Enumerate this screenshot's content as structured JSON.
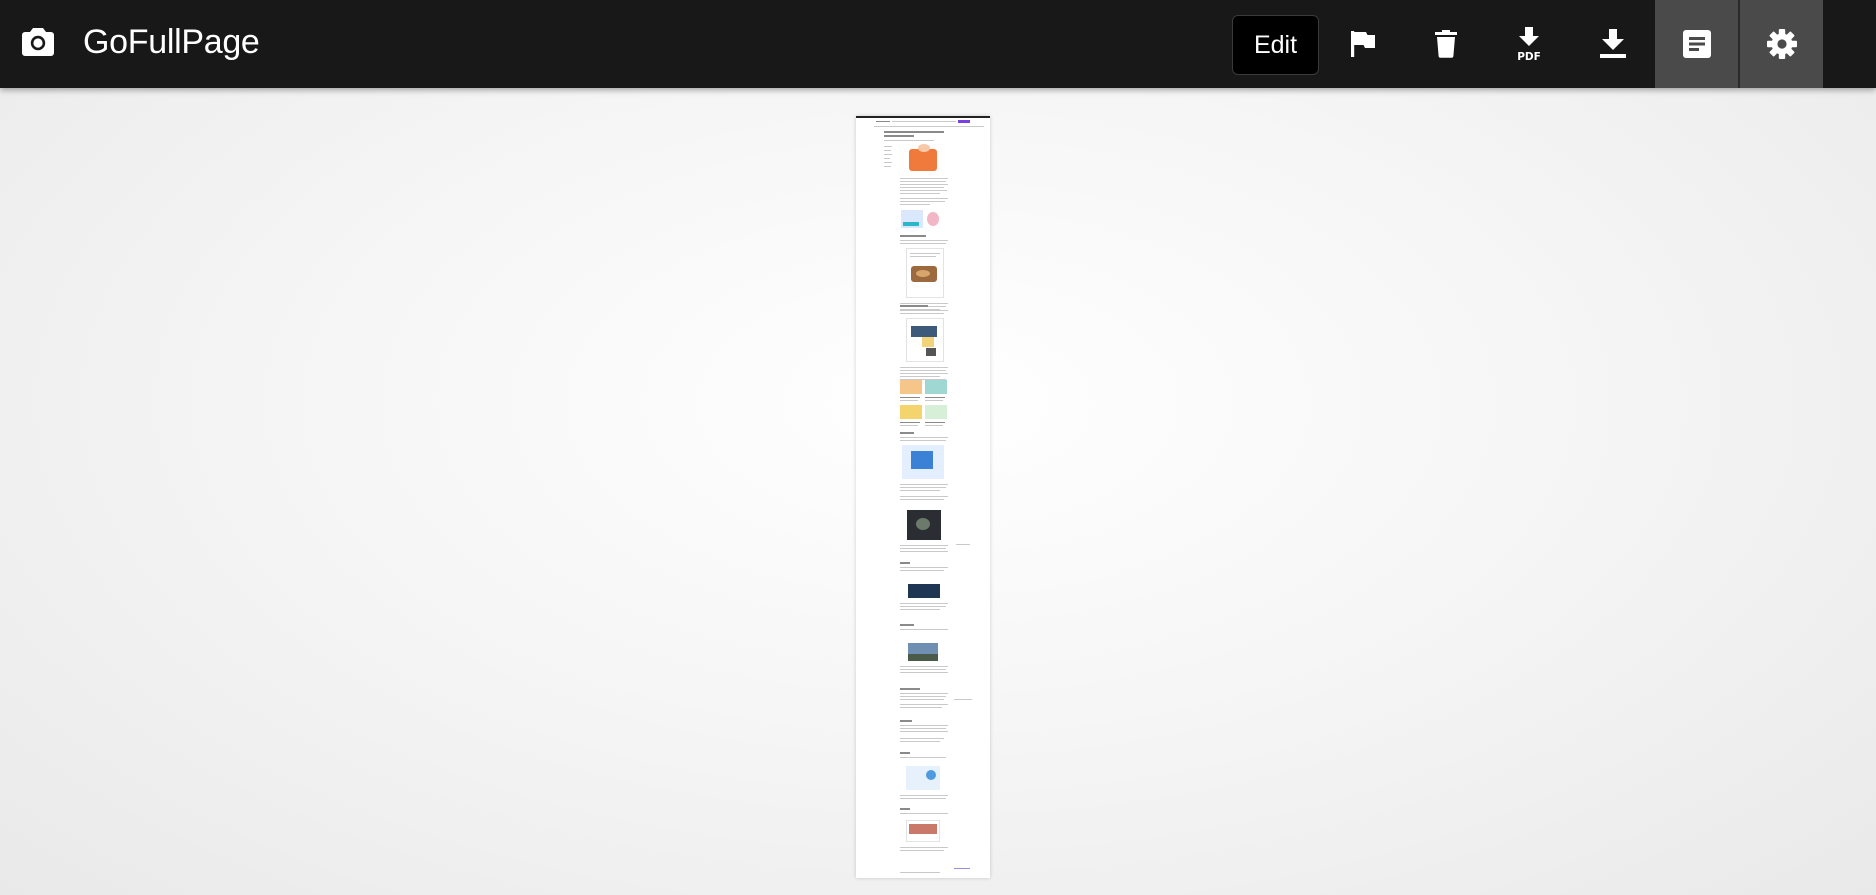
{
  "app": {
    "title": "GoFullPage",
    "logo_icon": "camera-icon"
  },
  "toolbar": {
    "edit_label": "Edit",
    "tools": [
      {
        "id": "flag",
        "icon": "flag-icon"
      },
      {
        "id": "delete",
        "icon": "trash-icon"
      },
      {
        "id": "download-pdf",
        "icon": "pdf-download-icon",
        "badge": "PDF"
      },
      {
        "id": "download-image",
        "icon": "download-icon"
      },
      {
        "id": "view-text",
        "icon": "document-icon",
        "active": true
      },
      {
        "id": "settings",
        "icon": "gear-icon",
        "active": true
      }
    ]
  },
  "colors": {
    "topbar": "#181818",
    "active_tool": "#4a4a4a",
    "edit_button": "#000000",
    "text": "#ffffff",
    "preview_accent": "#7b3fe4"
  },
  "preview": {
    "description_icon": "screenshot-thumbnail"
  }
}
